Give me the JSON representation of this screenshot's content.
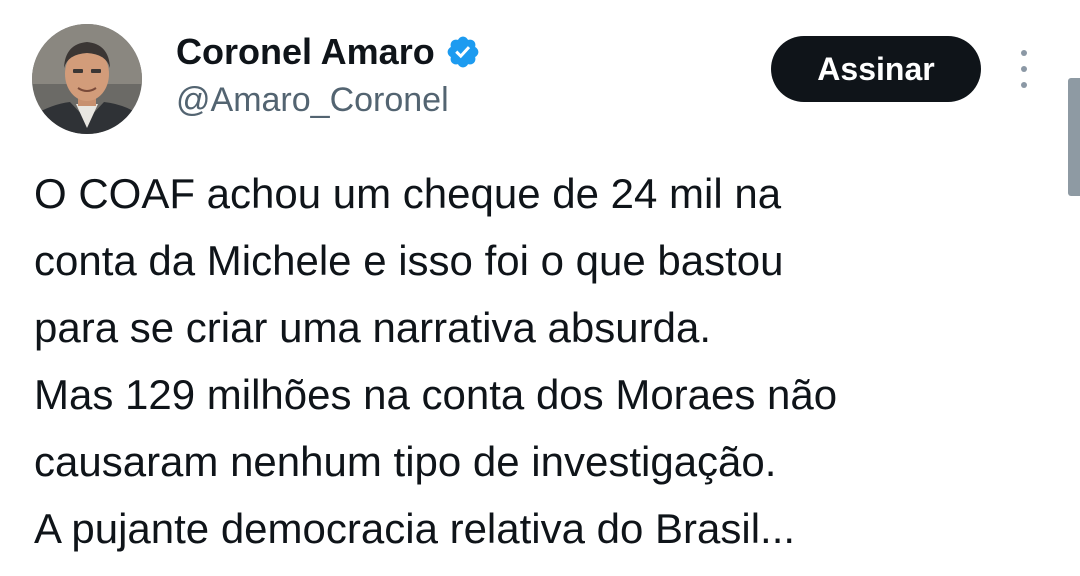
{
  "author": {
    "display_name": "Coronel Amaro",
    "handle": "@Amaro_Coronel",
    "verified": true,
    "verified_color": "#1d9bf0"
  },
  "actions": {
    "subscribe_label": "Assinar",
    "more_icon": "more-vertical-icon"
  },
  "tweet": {
    "lines": [
      "O COAF achou um cheque de 24 mil na",
      "conta da Michele e isso foi o que bastou",
      "para se criar uma narrativa absurda.",
      "Mas 129 milhões na conta dos Moraes não",
      "causaram nenhum tipo de investigação.",
      "A pujante democracia relativa do Brasil..."
    ]
  },
  "colors": {
    "text_primary": "#0f1419",
    "text_secondary": "#536471",
    "button_bg": "#0f1419",
    "button_text": "#ffffff",
    "accent": "#1d9bf0"
  }
}
